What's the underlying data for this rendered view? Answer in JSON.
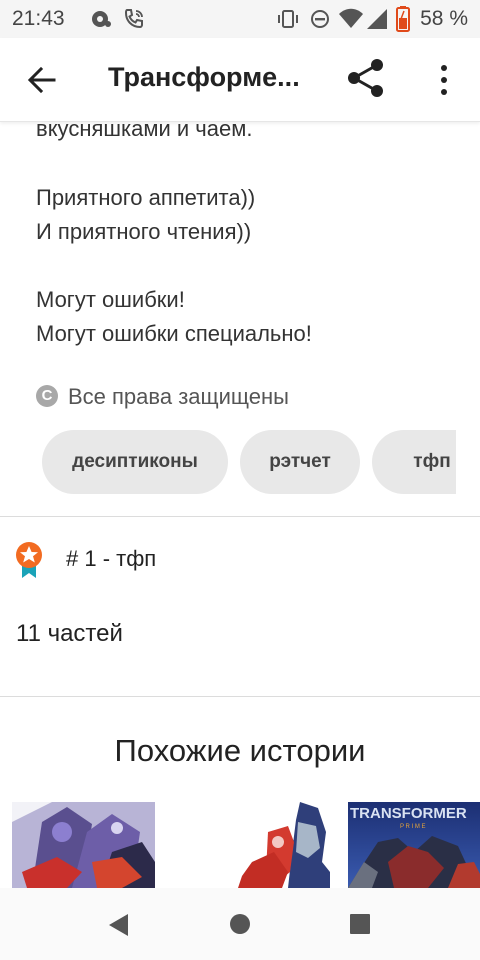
{
  "status_bar": {
    "time": "21:43",
    "battery_percent": "58 %",
    "icons": [
      "notification-icon",
      "phone-call-icon",
      "vibrate-icon",
      "do-not-disturb-icon",
      "wifi-icon",
      "signal-icon",
      "battery-icon"
    ]
  },
  "app_bar": {
    "title": "Трансформе...",
    "icons": [
      "back-arrow-icon",
      "share-icon",
      "more-vert-icon"
    ]
  },
  "story": {
    "lines": [
      "вкусняшками и чаем.",
      "Приятного аппетита))",
      "И приятного чтения))",
      "Могут ошибки!",
      "Могут ошибки специально!"
    ],
    "copyright_label": "Все права защищены",
    "copyright_symbol": "C"
  },
  "tags": [
    "десиптиконы",
    "рэтчет",
    "тфп"
  ],
  "ranking": {
    "label": "# 1 - тфп",
    "icon": "award-medal-icon"
  },
  "parts_label": "11 частей",
  "similar": {
    "title": "Похожие истории",
    "covers": [
      "cover-transformers-1",
      "cover-transformers-2",
      "cover-transformers-prime"
    ],
    "cover3_logo_text": "TRANSFORMER",
    "cover3_sub_text": "P R I M E"
  },
  "nav_bar": {
    "icons": [
      "nav-back-icon",
      "nav-home-icon",
      "nav-recents-icon"
    ]
  },
  "colors": {
    "tag_bg": "#e8e8e8",
    "medal_orange": "#f26b21",
    "medal_ribbon": "#1aa3b8"
  }
}
